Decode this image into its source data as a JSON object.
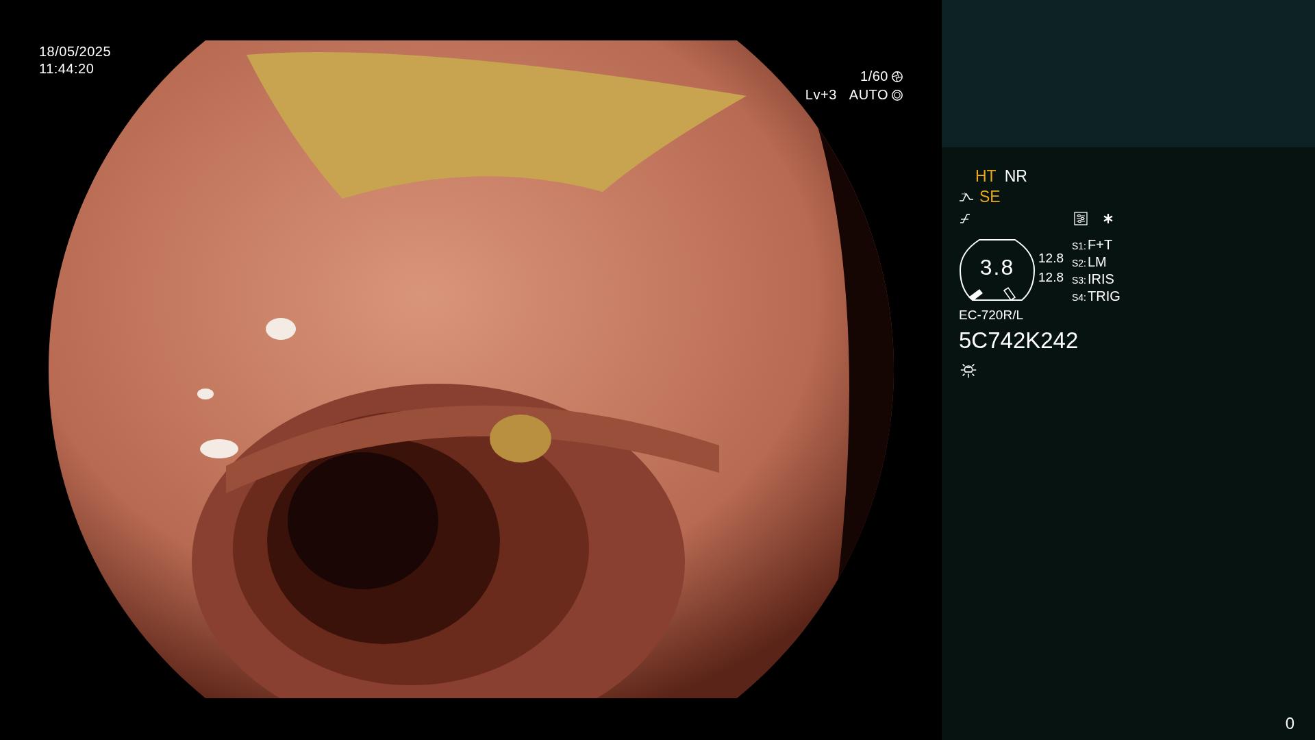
{
  "video": {
    "date": "18/05/2025",
    "time": "11:44:20",
    "shutter": "1/60",
    "level": "Lv+3",
    "iris": "AUTO"
  },
  "panel": {
    "indicators": [
      {
        "label": "HT",
        "color": "#e8a818"
      },
      {
        "label": "NR",
        "color": "#ffffff"
      }
    ],
    "enhancement": {
      "label": "SE",
      "color": "#e8a818"
    },
    "gauge": {
      "value": "3.8",
      "readings": [
        "12.8",
        "12.8"
      ]
    },
    "switches": [
      {
        "key": "S1:",
        "value": "F+T"
      },
      {
        "key": "S2:",
        "value": "LM"
      },
      {
        "key": "S3:",
        "value": "IRIS"
      },
      {
        "key": "S4:",
        "value": "TRIG"
      }
    ],
    "scope_model": "EC-720R/L",
    "serial": "5C742K242",
    "counter": "0"
  }
}
